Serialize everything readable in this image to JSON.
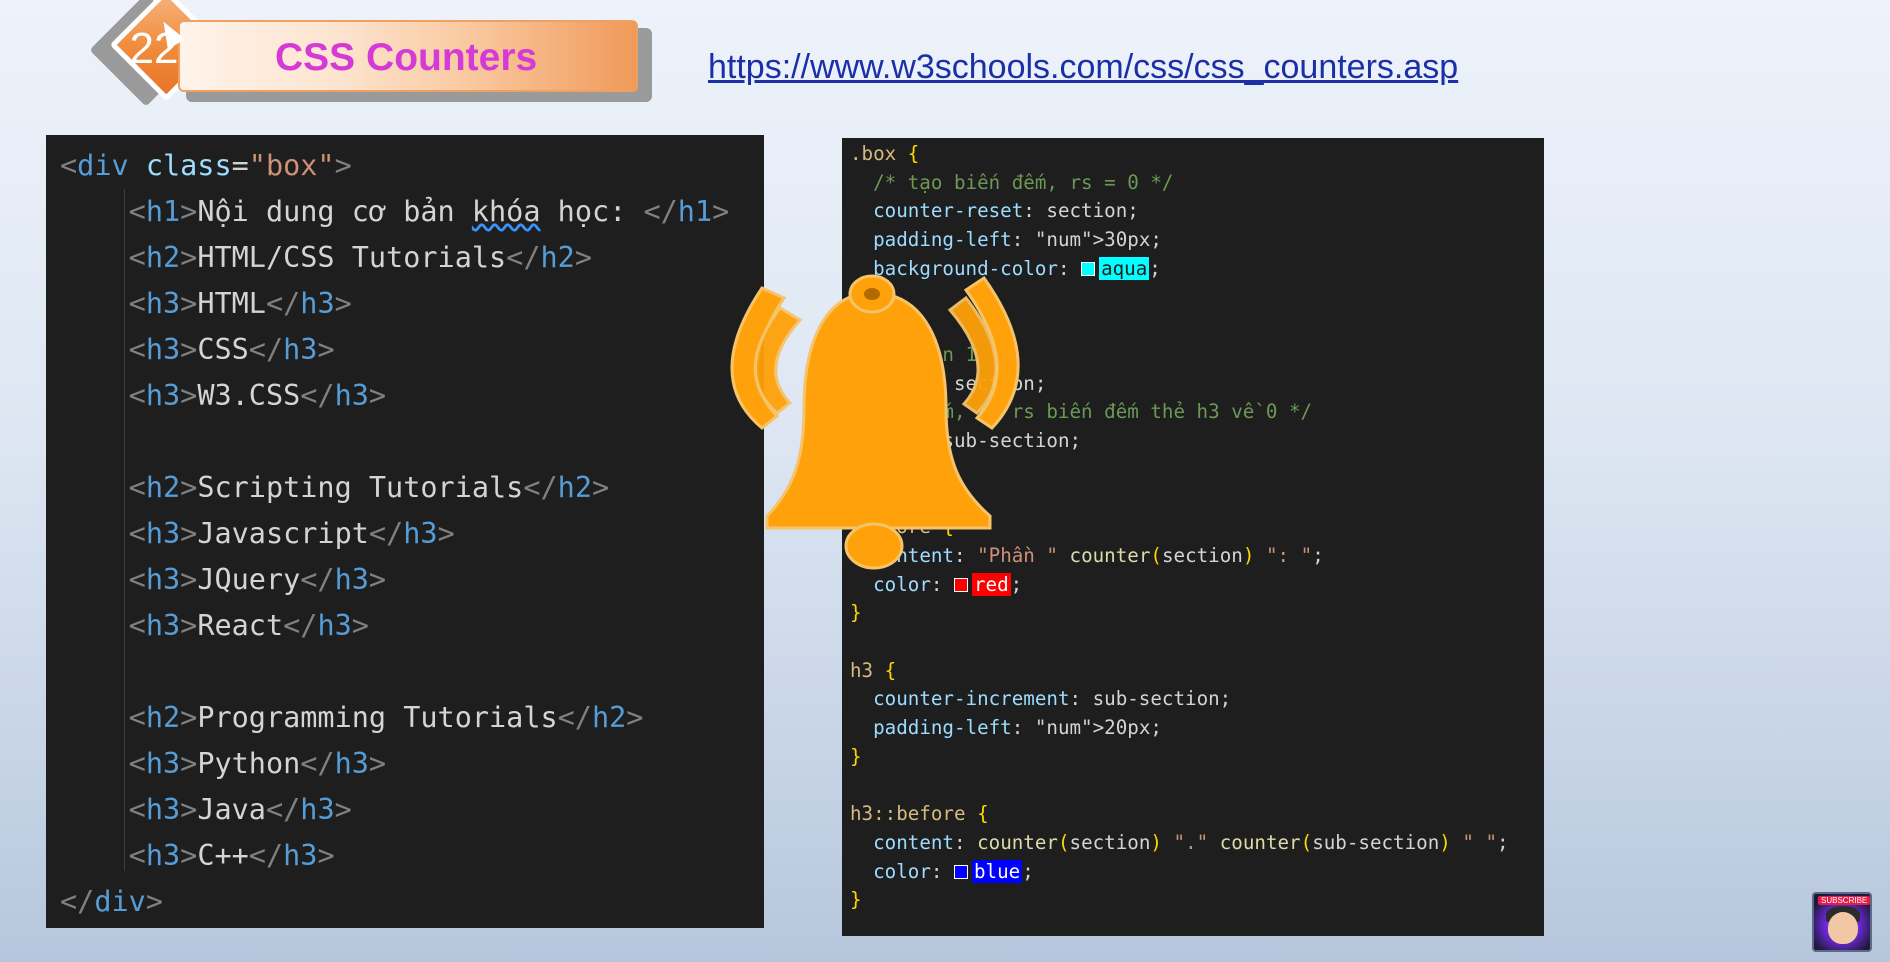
{
  "header": {
    "badge_number": "22",
    "title": "CSS Counters",
    "url": "https://www.w3schools.com/css/css_counters.asp"
  },
  "html_code": {
    "lines": [
      "<div class=\"box\">",
      "    <h1>Nội dung cơ bản khóa học: </h1>",
      "    <h2>HTML/CSS Tutorials</h2>",
      "    <h3>HTML</h3>",
      "    <h3>CSS</h3>",
      "    <h3>W3.CSS</h3>",
      "",
      "    <h2>Scripting Tutorials</h2>",
      "    <h3>Javascript</h3>",
      "    <h3>JQuery</h3>",
      "    <h3>React</h3>",
      "",
      "    <h2>Programming Tutorials</h2>",
      "    <h3>Python</h3>",
      "    <h3>Java</h3>",
      "    <h3>C++</h3>",
      "</div>"
    ]
  },
  "css_code": {
    "lines": [
      ".box {",
      "  /* tạo biến đếm, rs = 0 */",
      "  counter-reset: section;",
      "  padding-left: 30px;",
      "  background-color: aqua;",
      "",
      "",
      "  đếm lên 1 */",
      "  ement: section;",
      "  iến đếm, và rs biến đếm thẻ h3 về 0 */",
      "  eset: sub-section;",
      "",
      "",
      "  efore {",
      "  content: \"Phần \" counter(section) \": \";",
      "  color: red;",
      "}",
      "",
      "h3 {",
      "  counter-increment: sub-section;",
      "  padding-left: 20px;",
      "}",
      "",
      "h3::before {",
      "  content: counter(section) \".\" counter(sub-section) \" \";",
      "  color: blue;",
      "}"
    ],
    "swatch_colors": {
      "aqua": "#00ffff",
      "red": "#ff0000",
      "blue": "#0000ff"
    }
  },
  "overlay": {
    "icon": "bell-icon",
    "color": "#ffa10a"
  },
  "thumbnail": {
    "label": "SUBSCRIBE"
  }
}
